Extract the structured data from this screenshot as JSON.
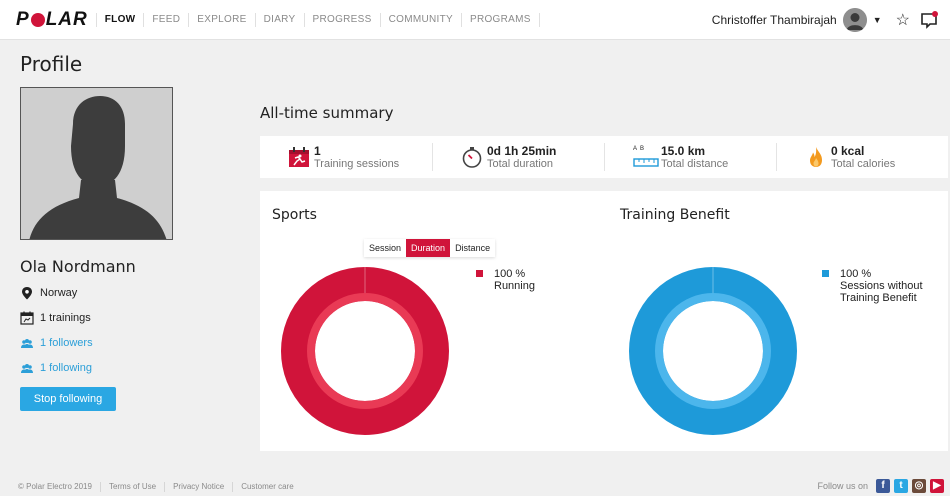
{
  "brand": {
    "logo_text_left": "P",
    "logo_text_right": "LAR",
    "accent": "#d0143a",
    "link_color": "#2aa7e3"
  },
  "nav": {
    "items": [
      {
        "label": "FLOW",
        "active": true
      },
      {
        "label": "FEED"
      },
      {
        "label": "EXPLORE"
      },
      {
        "label": "DIARY"
      },
      {
        "label": "PROGRESS"
      },
      {
        "label": "COMMUNITY"
      },
      {
        "label": "PROGRAMS"
      }
    ]
  },
  "user": {
    "name": "Christoffer Thambirajah",
    "icons": [
      "avatar",
      "chevron-down-icon",
      "star-icon",
      "notification-icon"
    ]
  },
  "page": {
    "title": "Profile"
  },
  "profile": {
    "name": "Ola Nordmann",
    "location": "Norway",
    "trainings": "1 trainings",
    "followers": "1 followers",
    "following": "1 following",
    "button": "Stop following"
  },
  "summary": {
    "title": "All-time summary",
    "stats": [
      {
        "value": "1",
        "label": "Training sessions",
        "icon": "training-calendar-icon"
      },
      {
        "value": "0d 1h 25min",
        "label": "Total duration",
        "icon": "stopwatch-icon"
      },
      {
        "value": "15.0 km",
        "label": "Total distance",
        "icon": "ruler-icon",
        "prefix": "A  B"
      },
      {
        "value": "0 kcal",
        "label": "Total calories",
        "icon": "flame-icon"
      }
    ]
  },
  "sports": {
    "title": "Sports",
    "toggles": [
      {
        "label": "Session"
      },
      {
        "label": "Duration",
        "active": true
      },
      {
        "label": "Distance"
      }
    ],
    "legend": {
      "percent": "100 %",
      "name": "Running",
      "color": "#d0143a"
    }
  },
  "benefit": {
    "title": "Training Benefit",
    "legend": {
      "percent": "100 %",
      "name_line1": "Sessions without",
      "name_line2": "Training Benefit",
      "color": "#1e9ad9"
    }
  },
  "chart_data": [
    {
      "type": "pie",
      "categories": [
        "Running"
      ],
      "values": [
        100
      ],
      "title": "Sports"
    },
    {
      "type": "pie",
      "categories": [
        "Sessions without Training Benefit"
      ],
      "values": [
        100
      ],
      "title": "Training Benefit"
    }
  ],
  "footer": {
    "items": [
      "© Polar Electro 2019",
      "Terms of Use",
      "Privacy Notice",
      "Customer care"
    ],
    "follow": "Follow us on",
    "social": [
      "facebook-icon",
      "twitter-icon",
      "instagram-icon",
      "youtube-icon"
    ]
  }
}
